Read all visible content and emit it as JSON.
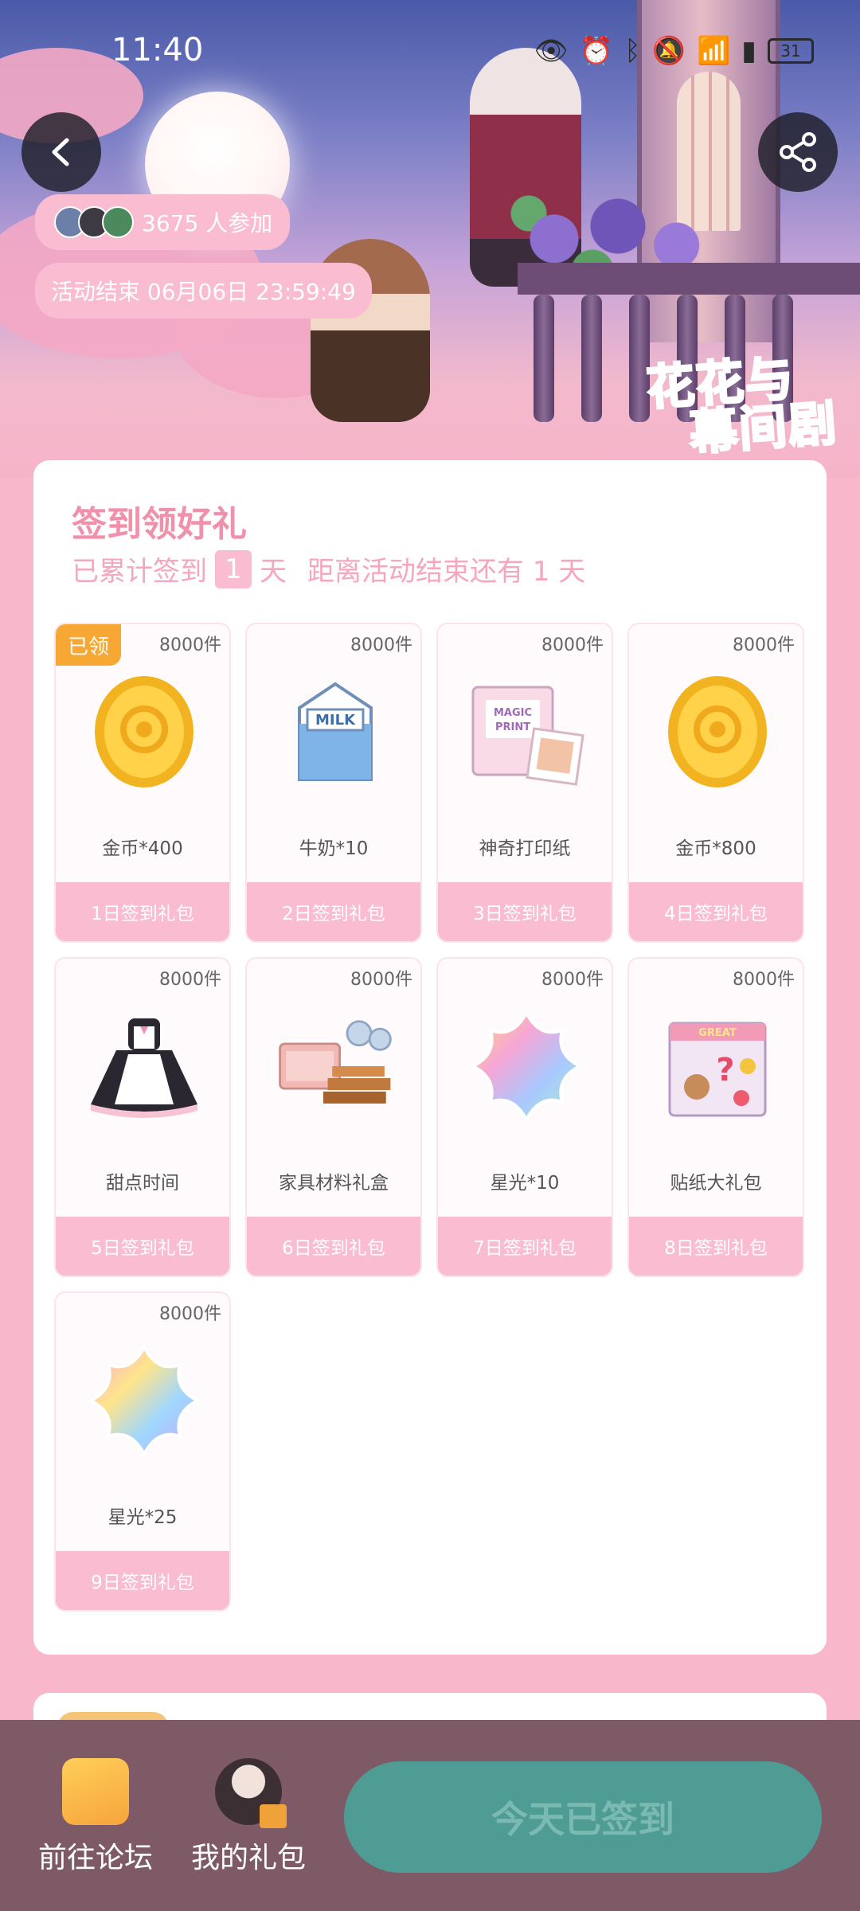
{
  "status_bar": {
    "time": "11:40",
    "battery": "31",
    "icons": [
      "eye-icon",
      "alarm-icon",
      "bluetooth-icon",
      "mute-icon",
      "wifi-icon",
      "signal-icon",
      "battery-icon"
    ]
  },
  "header": {
    "participants": "3675 人参加",
    "end_time": "活动结束 06月06日 23:59:49",
    "banner_logo_line1": "花花与",
    "banner_logo_line2": "幕间剧"
  },
  "signin": {
    "title": "签到领好礼",
    "progress_prefix": "已累计签到",
    "days_count": "1",
    "progress_suffix": "天",
    "remaining": "距离活动结束还有 1 天",
    "claimed_badge": "已领",
    "gifts": [
      {
        "qty": "8000件",
        "name": "金币*400",
        "label": "1日签到礼包",
        "claimed": true,
        "icon": "gold-coin-icon"
      },
      {
        "qty": "8000件",
        "name": "牛奶*10",
        "label": "2日签到礼包",
        "claimed": false,
        "icon": "milk-carton-icon"
      },
      {
        "qty": "8000件",
        "name": "神奇打印纸",
        "label": "3日签到礼包",
        "claimed": false,
        "icon": "magic-print-paper-icon"
      },
      {
        "qty": "8000件",
        "name": "金币*800",
        "label": "4日签到礼包",
        "claimed": false,
        "icon": "gold-coin-icon"
      },
      {
        "qty": "8000件",
        "name": "甜点时间",
        "label": "5日签到礼包",
        "claimed": false,
        "icon": "maid-dress-icon"
      },
      {
        "qty": "8000件",
        "name": "家具材料礼盒",
        "label": "6日签到礼包",
        "claimed": false,
        "icon": "furniture-materials-icon"
      },
      {
        "qty": "8000件",
        "name": "星光*10",
        "label": "7日签到礼包",
        "claimed": false,
        "icon": "starlight-icon"
      },
      {
        "qty": "8000件",
        "name": "贴纸大礼包",
        "label": "8日签到礼包",
        "claimed": false,
        "icon": "sticker-pack-icon"
      },
      {
        "qty": "8000件",
        "name": "星光*25",
        "label": "9日签到礼包",
        "claimed": false,
        "icon": "starlight-icon"
      }
    ]
  },
  "bottom_bar": {
    "forum_label": "前往论坛",
    "gifts_label": "我的礼包",
    "signed_button": "今天已签到"
  },
  "colors": {
    "page_bg": "#f8b7cb",
    "pink_accent": "#f9bcd0",
    "title_pink": "#f090aa",
    "claimed_orange": "#f7a733",
    "bottom_bar": "#7e5a66",
    "signed_button": "#4f9c95"
  }
}
